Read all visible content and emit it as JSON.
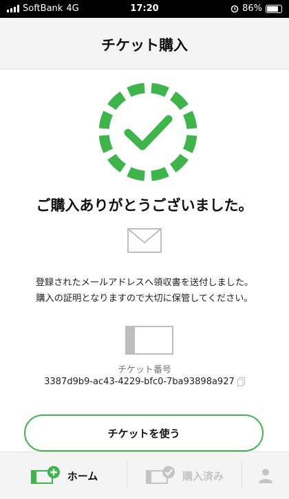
{
  "status_bar": {
    "carrier": "SoftBank",
    "network": "4G",
    "time": "17:20",
    "battery": "86%"
  },
  "header": {
    "title": "チケット購入"
  },
  "main": {
    "thanks_title": "ご購入ありがとうございました。",
    "receipt_line1": "登録されたメールアドレスへ領収書を送付しました。",
    "receipt_line2": "購入の証明となりますので大切に保管してください。",
    "ticket_number_label": "チケット番号",
    "ticket_number": "3387d9b9-ac43-4229-bfc0-7ba93898a927",
    "use_button": "チケットを使う"
  },
  "tabbar": {
    "home_label": "ホーム",
    "purchased_label": "購入済み"
  },
  "colors": {
    "accent": "#3db54a",
    "inactive": "#c4c4c4"
  },
  "icons": [
    "check-circle-icon",
    "mail-icon",
    "ticket-icon",
    "copy-icon",
    "home-plus-icon",
    "purchased-check-icon",
    "account-icon"
  ]
}
